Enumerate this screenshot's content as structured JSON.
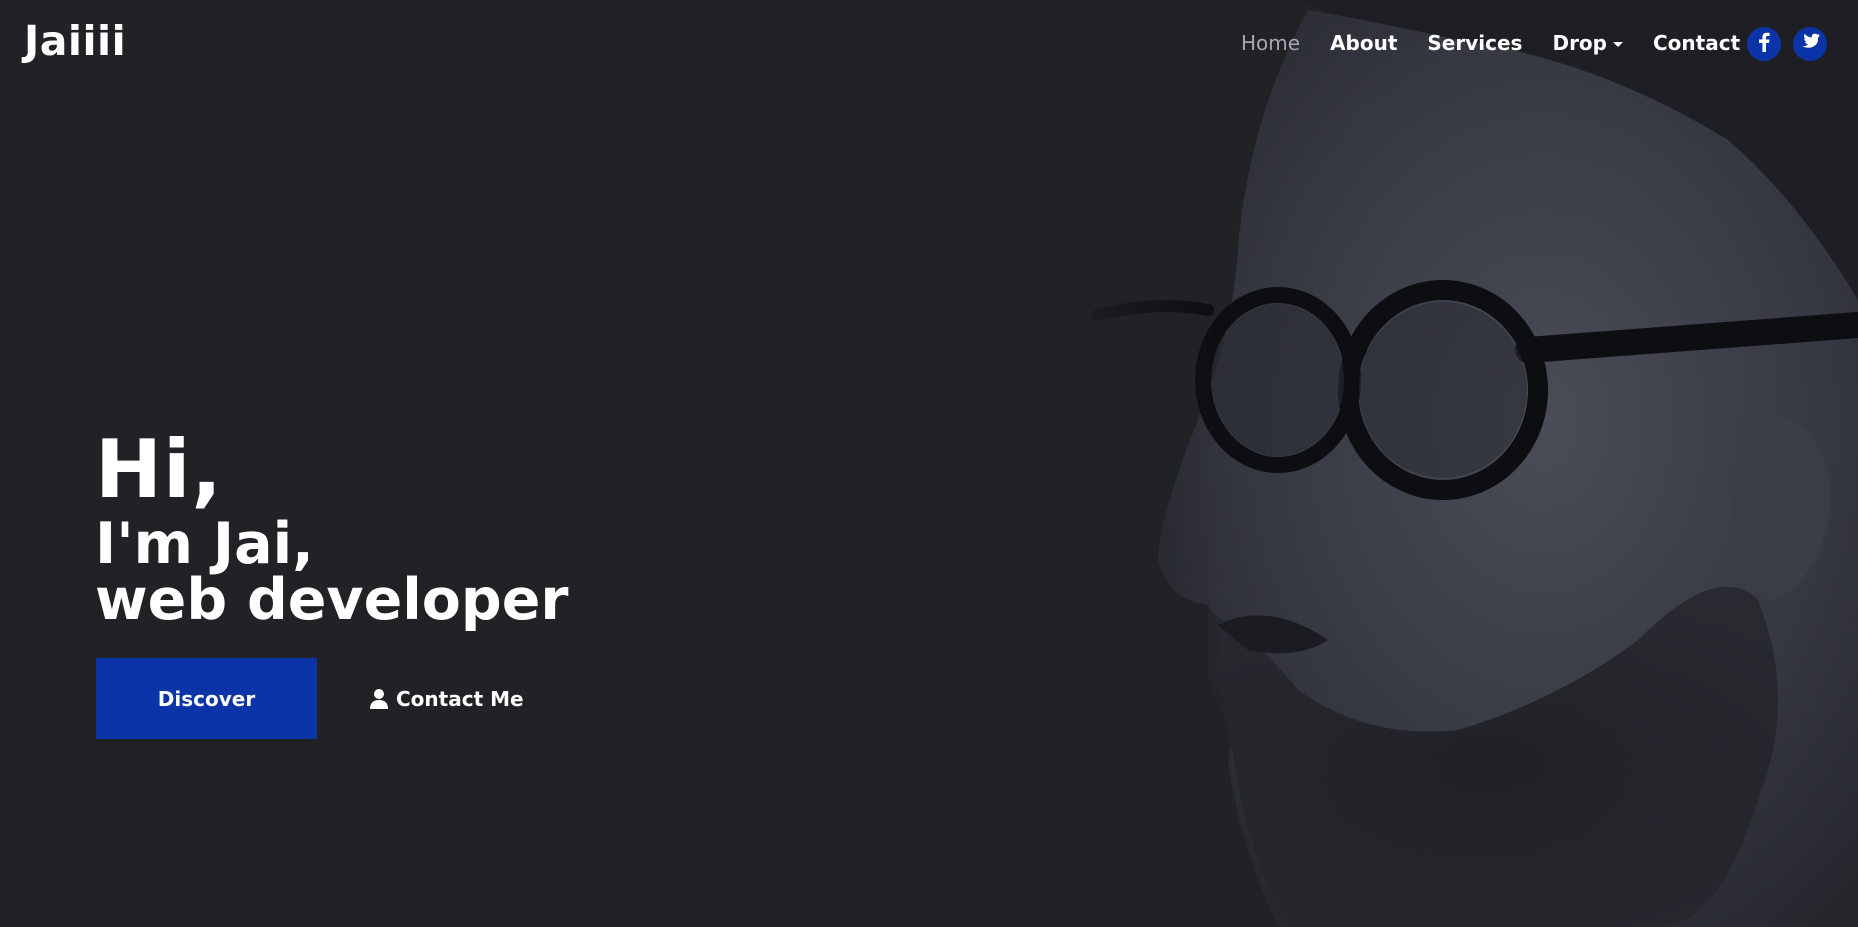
{
  "brand": {
    "name": "Jaiiii"
  },
  "nav": {
    "items": [
      {
        "label": "Home",
        "active": true
      },
      {
        "label": "About",
        "active": false
      },
      {
        "label": "Services",
        "active": false
      },
      {
        "label": "Drop",
        "active": false,
        "dropdown": true
      },
      {
        "label": "Contact",
        "active": false
      }
    ],
    "social": [
      {
        "icon": "facebook-icon"
      },
      {
        "icon": "twitter-icon"
      }
    ]
  },
  "hero": {
    "greeting": "Hi,",
    "line1": "I'm Jai,",
    "line2": "web developer",
    "primary_button": "Discover",
    "secondary_button": "Contact Me",
    "secondary_icon": "user-icon"
  },
  "colors": {
    "background": "#212226",
    "accent": "#0b34a8",
    "nav_active": "#a5a8b0",
    "text": "#ffffff"
  }
}
